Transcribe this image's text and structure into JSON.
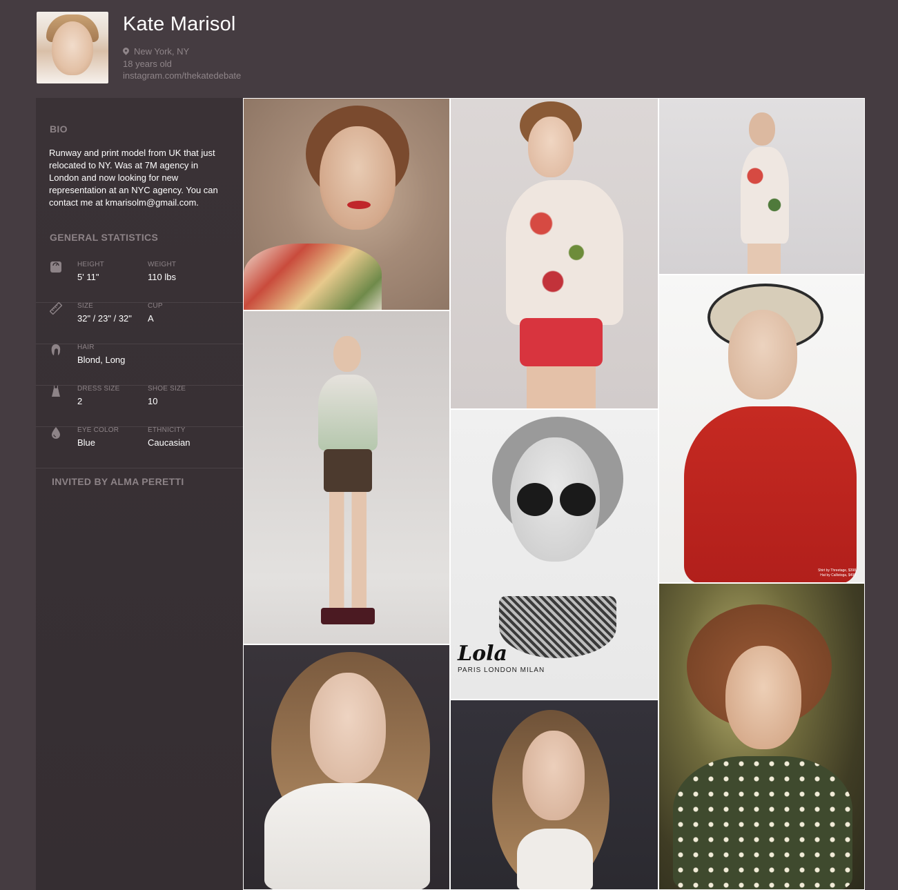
{
  "profile": {
    "name": "Kate Marisol",
    "location": "New York, NY",
    "age": "18 years old",
    "instagram": "instagram.com/thekatedebate"
  },
  "sidebar": {
    "bio_title": "BIO",
    "bio_text": "Runway and print model from UK that just relocated to NY. Was at 7M agency in London and now looking for new representation at an NYC agency. You can contact me at kmarisolm@gmail.com.",
    "stats_title": "GENERAL STATISTICS",
    "stats": [
      {
        "icon": "scale-icon",
        "label1": "HEIGHT",
        "value1": "5' 11\"",
        "label2": "WEIGHT",
        "value2": "110 lbs"
      },
      {
        "icon": "ruler-icon",
        "label1": "SIZE",
        "value1": "32\" / 23\" / 32\"",
        "label2": "CUP",
        "value2": "A"
      },
      {
        "icon": "hair-icon",
        "label1": "HAIR",
        "value1": "Blond, Long",
        "label2": "",
        "value2": ""
      },
      {
        "icon": "dress-icon",
        "label1": "DRESS SIZE",
        "value1": "2",
        "label2": "SHOE SIZE",
        "value2": "10"
      },
      {
        "icon": "drop-icon",
        "label1": "EYE COLOR",
        "value1": "Blue",
        "label2": "ETHNICITY",
        "value2": "Caucasian"
      }
    ],
    "invited_by": "INVITED BY ALMA PERETTI"
  },
  "gallery": {
    "lola_logo": "Lola",
    "lola_tagline": "PARIS LONDON MILAN",
    "credit_line1": "Shirt by Threetage, $398",
    "credit_line2": "Hat by Callistoga, $499"
  },
  "colors": {
    "page_bg": "#453c41",
    "sidebar_bg": "#3a3236",
    "muted_text": "#8d8387"
  }
}
